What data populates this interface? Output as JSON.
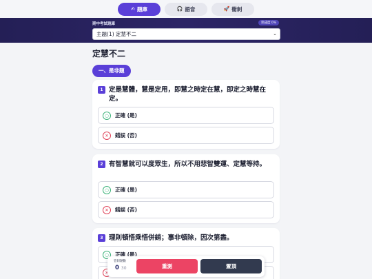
{
  "tabs": [
    {
      "icon": "✍",
      "label": "題庫",
      "active": true
    },
    {
      "icon": "🎧",
      "label": "語音",
      "active": false
    },
    {
      "icon": "🚀",
      "label": "衝刺",
      "active": false
    }
  ],
  "header": {
    "label": "期中考試題庫",
    "progress_badge": "完成度 0%",
    "select_value": "主題(1) 定慧不二"
  },
  "page_title": "定慧不二",
  "section": "一、是非題",
  "questions": [
    {
      "num": "1",
      "text": "定是慧體，慧是定用，即慧之時定在慧，即定之時慧在定。"
    },
    {
      "num": "2",
      "text": "有智慧就可以度眾生，所以不用悲智雙運、定慧等持。"
    },
    {
      "num": "3",
      "text": "理則頓悟乘悟併銷；事非頓除，因次第盡。"
    }
  ],
  "options": {
    "true_icon": "○",
    "true_label": "正確 (是)",
    "false_icon": "✕",
    "false_label": "錯誤 (否)"
  },
  "bottom": {
    "count_label": "答對題數",
    "count": "0",
    "total": "30",
    "test_label": "重測",
    "reset_label": "置頂"
  },
  "colors": {
    "accent": "#5a3fd8",
    "header_bg": "#241f56",
    "true": "#3db37a",
    "false": "#e0445a",
    "test_btn": "#ec4464",
    "reset_btn": "#323a4f"
  }
}
